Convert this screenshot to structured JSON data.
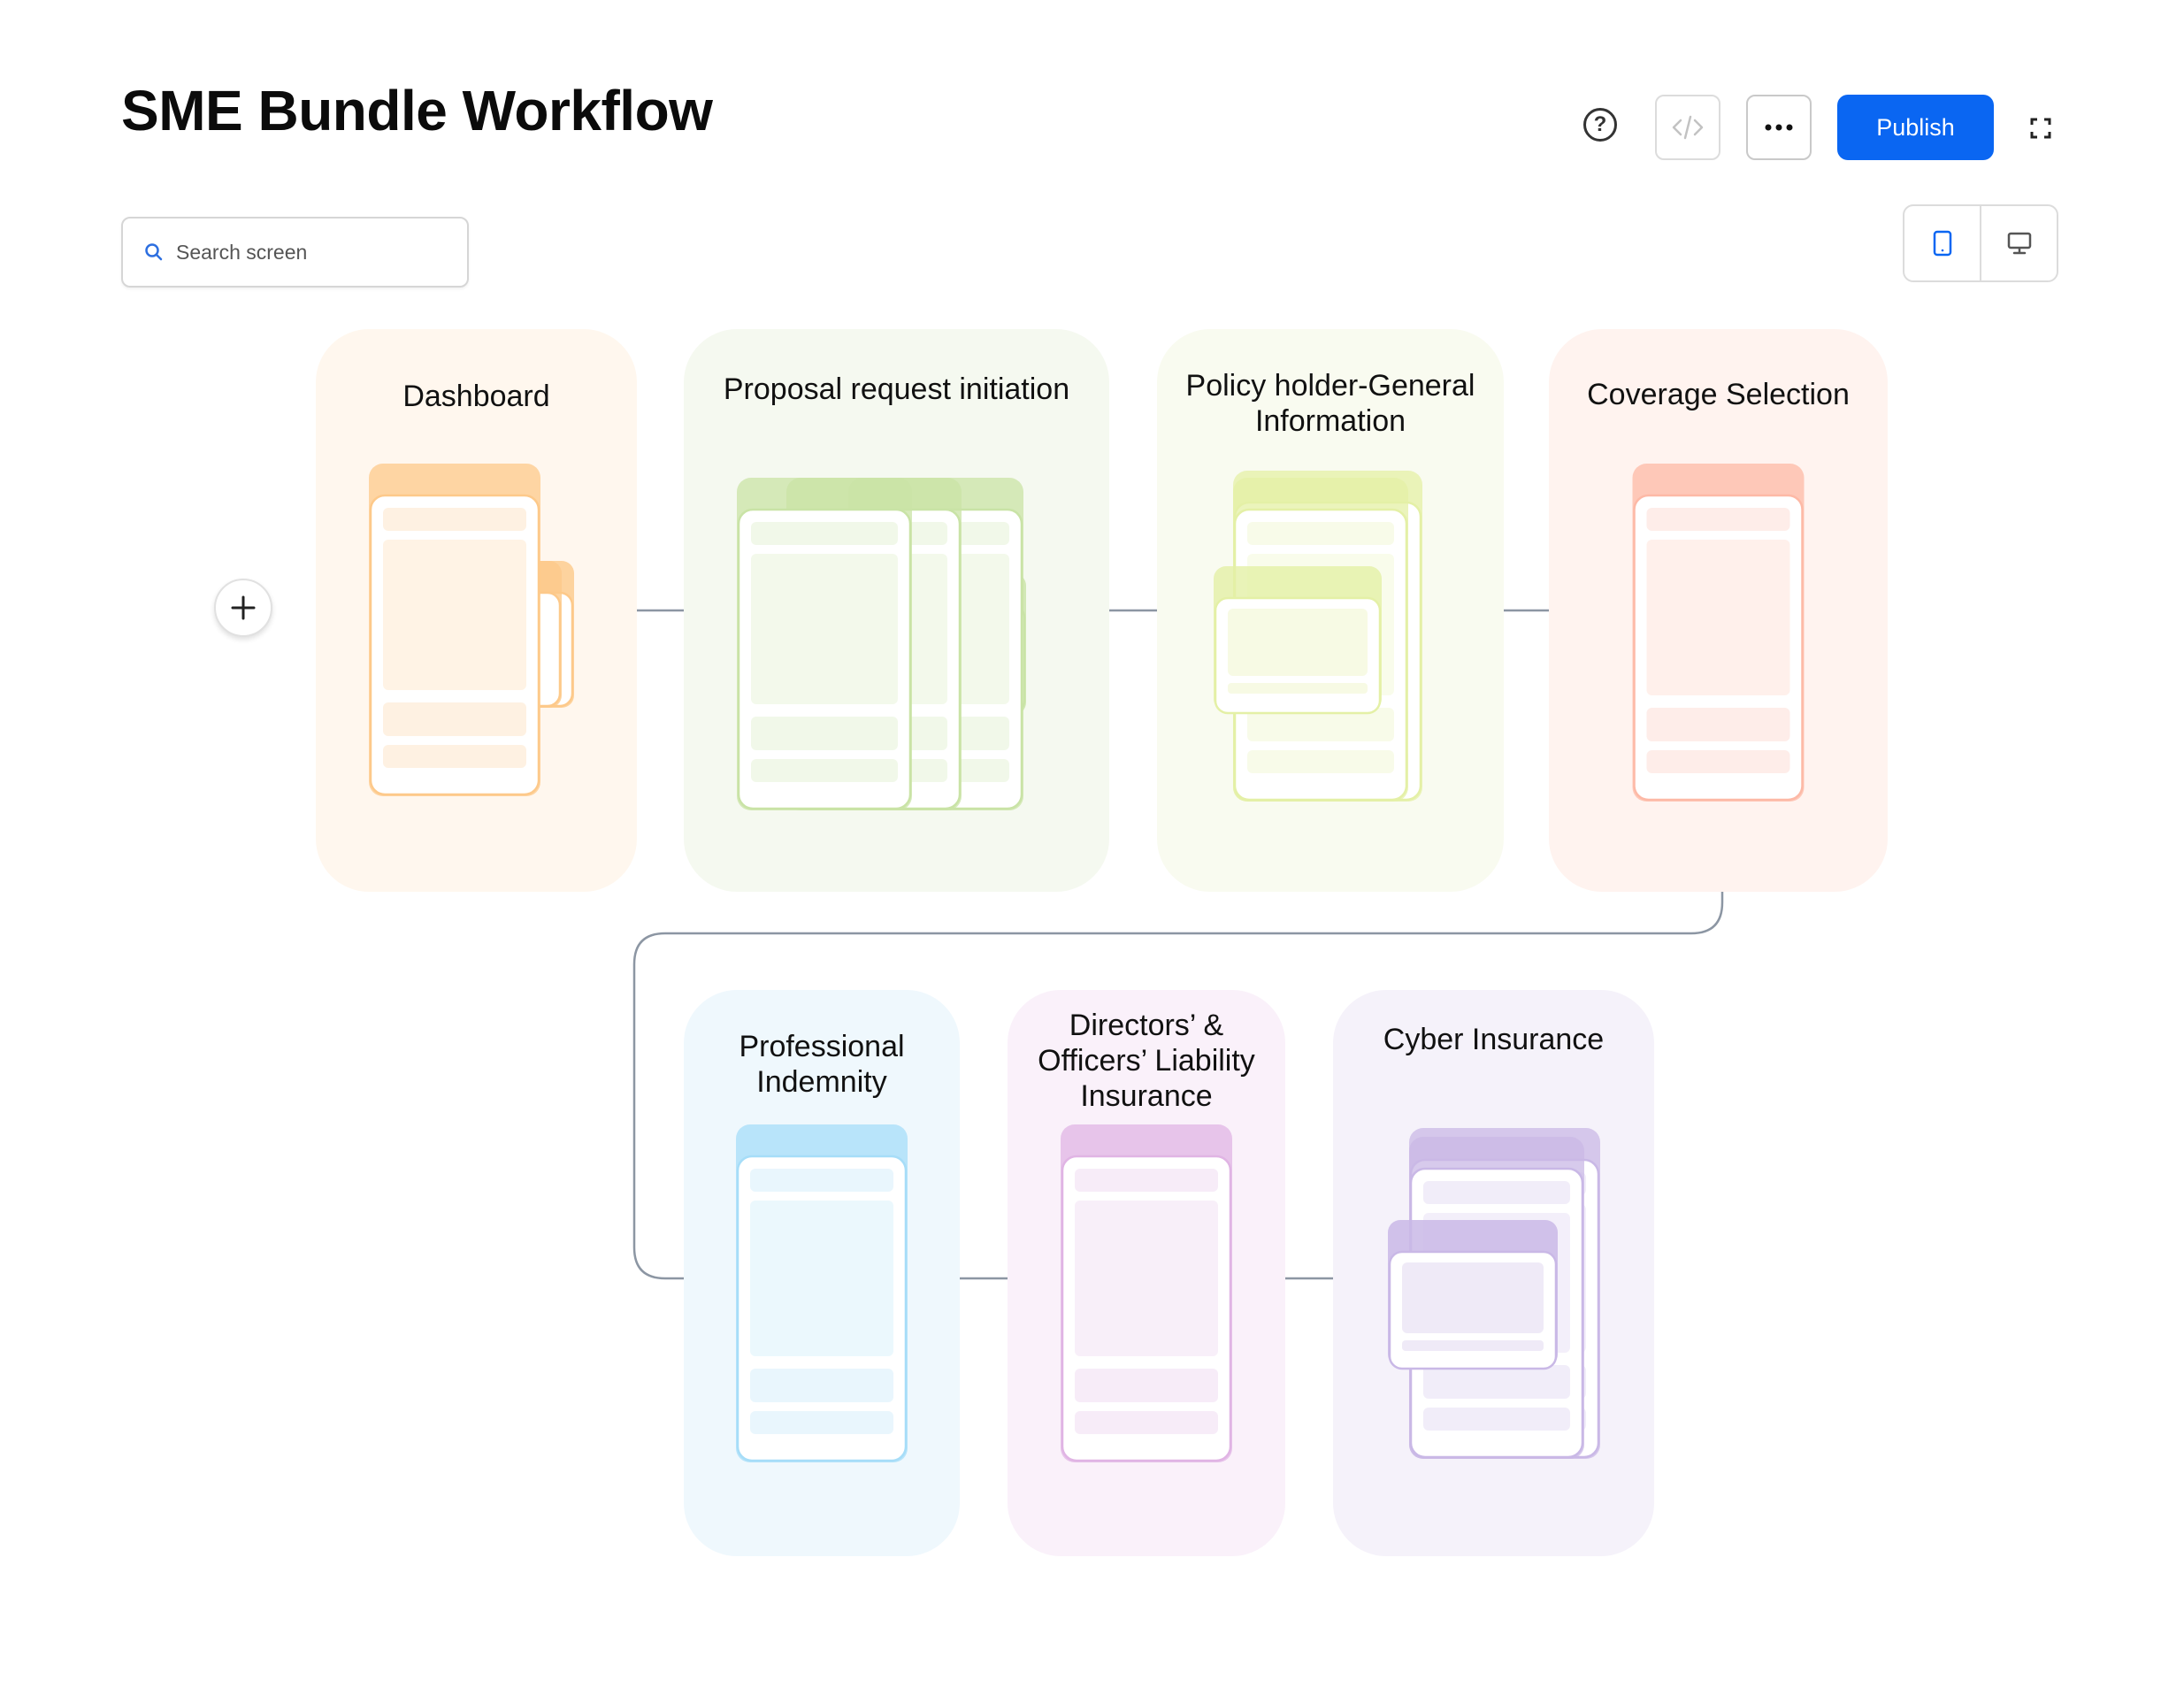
{
  "header": {
    "title": "SME Bundle Workflow",
    "help_icon": "question-circle-icon",
    "code_icon": "code-icon",
    "more_icon": "more-horizontal-icon",
    "publish_label": "Publish",
    "expand_icon": "fullscreen-icon"
  },
  "search": {
    "placeholder": "Search screen",
    "icon": "search-icon"
  },
  "device_toggle": {
    "options": [
      "mobile",
      "desktop"
    ],
    "selected": "mobile"
  },
  "add_icon": "plus-icon",
  "colors": {
    "accent": "#0A66F2",
    "connector": "#8C96A3"
  },
  "workflow": [
    {
      "label": "Dashboard",
      "color": "#FDC98A",
      "bg": "#FFF7EE"
    },
    {
      "label": "Proposal request initiation",
      "color": "#C9E3A6",
      "bg": "#F5F9F0"
    },
    {
      "label": "Policy holder-General Information",
      "color": "#E4F0A6",
      "bg": "#F9FBF0"
    },
    {
      "label": "Coverage Selection",
      "color": "#FDB9A6",
      "bg": "#FFF3EF"
    },
    {
      "label": "Professional Indemnity",
      "color": "#A6DDF8",
      "bg": "#EFF8FD"
    },
    {
      "label": "Directors’ & Officers’ Liability Insurance",
      "color": "#E0B4E4",
      "bg": "#FAF1FA"
    },
    {
      "label": "Cyber Insurance",
      "color": "#C9B8E6",
      "bg": "#F5F2FA"
    }
  ]
}
